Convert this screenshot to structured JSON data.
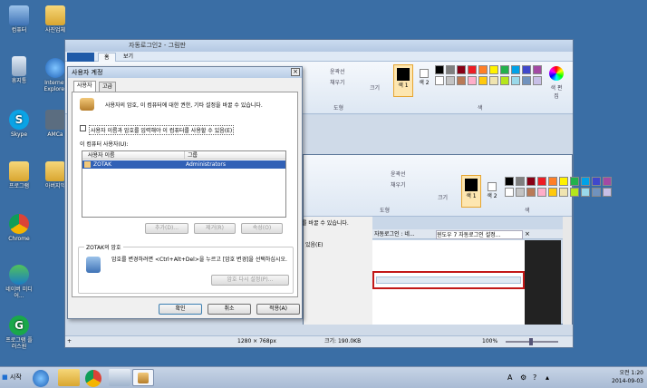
{
  "desktop": {
    "icons": [
      {
        "label": "컴퓨터"
      },
      {
        "label": "사진업체"
      },
      {
        "label": "휴지통"
      },
      {
        "label": "Internet Explorer"
      },
      {
        "label": "Skype"
      },
      {
        "label": "AMCa"
      },
      {
        "label": "프로그램"
      },
      {
        "label": "아버지익"
      },
      {
        "label": "Chrome"
      },
      {
        "label": "네이버 미디어..."
      },
      {
        "label": "프로그램 플러스원"
      }
    ]
  },
  "paint": {
    "title": "자동로그인2 - 그림판",
    "tabs": [
      "홈",
      "보기"
    ],
    "ribbon": {
      "outline_label": "윤곽선",
      "fill_label": "채우기",
      "shapes_group": "도형",
      "size_label": "크기",
      "color1_label": "색 1",
      "color2_label": "색 2",
      "colors_group": "색",
      "edit_colors_label": "색 편집"
    },
    "status": {
      "dimensions": "1280 × 768px",
      "file_size": "크기: 190.0KB",
      "zoom": "100%"
    }
  },
  "paint2": {
    "ribbon": {
      "outline_label": "윤곽선",
      "fill_label": "채우기",
      "shapes_group": "도형",
      "size_label": "크기",
      "color1_label": "색 1",
      "color2_label": "색 2",
      "colors_group": "색"
    },
    "behind_text_1": "를 바꿀 수 있습니다.",
    "behind_text_2": "있음(E)",
    "browser_tabs": [
      "자동로그인 : 네...",
      "윈도우 7 자동로그인 설정..."
    ]
  },
  "dialog": {
    "title": "사용자 계정",
    "tabs": [
      "사용자",
      "고급"
    ],
    "description": "사용자의 암호, 이 컴퓨터에 대한 권한, 기타 설정을 바꿀 수 있습니다.",
    "checkbox_label": "사용자 이름과 암호를 입력해야 이 컴퓨터를 사용할 수 있음(E)",
    "users_heading": "이 컴퓨터 사용자(U):",
    "columns": [
      "사용자 이름",
      "그룹"
    ],
    "rows": [
      {
        "user": "ZOTAK",
        "group": "Administrators"
      }
    ],
    "buttons": {
      "add": "추가(D)...",
      "remove": "제거(R)",
      "properties": "속성(O)"
    },
    "password_group": "ZOTAK의 암호",
    "password_text": "암호를 변경하려면 <Ctrl+Alt+Del>을 누르고 [암호 변경]을 선택하십시오.",
    "reset_password": "암호 다시 설정(P)...",
    "ok": "확인",
    "cancel": "취소",
    "apply": "적용(A)"
  },
  "taskbar": {
    "start_label": "시작",
    "tray_language": "A",
    "time": "오전 1:20",
    "date": "2014-09-03"
  },
  "palette": [
    "#000000",
    "#7f7f7f",
    "#880015",
    "#ed1c24",
    "#ff7f27",
    "#fff200",
    "#22b14c",
    "#00a2e8",
    "#3f48cc",
    "#a349a4",
    "#ffffff",
    "#c3c3c3",
    "#b97a57",
    "#ffaec9",
    "#ffc90e",
    "#efe4b0",
    "#b5e61d",
    "#99d9ea",
    "#7092be",
    "#c8bfe7"
  ]
}
